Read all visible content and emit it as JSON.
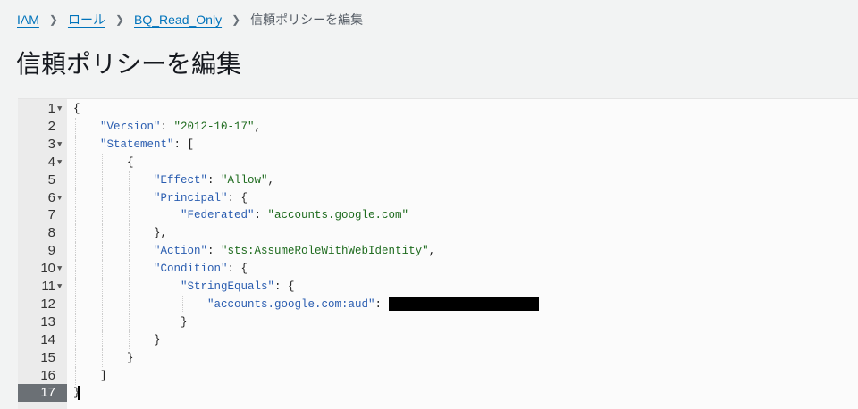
{
  "breadcrumb": [
    {
      "label": "IAM",
      "link": true
    },
    {
      "label": "ロール",
      "link": true
    },
    {
      "label": "BQ_Read_Only",
      "link": true
    },
    {
      "label": "信頼ポリシーを編集",
      "link": false
    }
  ],
  "page_title": "信頼ポリシーを編集",
  "editor": {
    "active_line": 17,
    "lines": [
      {
        "n": "1",
        "fold": true,
        "indent": 0,
        "tokens": [
          [
            "p",
            "{"
          ]
        ]
      },
      {
        "n": "2",
        "fold": false,
        "indent": 1,
        "tokens": [
          [
            "k",
            "\"Version\""
          ],
          [
            "p",
            ": "
          ],
          [
            "s",
            "\"2012-10-17\""
          ],
          [
            "p",
            ","
          ]
        ]
      },
      {
        "n": "3",
        "fold": true,
        "indent": 1,
        "tokens": [
          [
            "k",
            "\"Statement\""
          ],
          [
            "p",
            ": ["
          ]
        ]
      },
      {
        "n": "4",
        "fold": true,
        "indent": 2,
        "tokens": [
          [
            "p",
            "{"
          ]
        ]
      },
      {
        "n": "5",
        "fold": false,
        "indent": 3,
        "tokens": [
          [
            "k",
            "\"Effect\""
          ],
          [
            "p",
            ": "
          ],
          [
            "s",
            "\"Allow\""
          ],
          [
            "p",
            ","
          ]
        ]
      },
      {
        "n": "6",
        "fold": true,
        "indent": 3,
        "tokens": [
          [
            "k",
            "\"Principal\""
          ],
          [
            "p",
            ": {"
          ]
        ]
      },
      {
        "n": "7",
        "fold": false,
        "indent": 4,
        "tokens": [
          [
            "k",
            "\"Federated\""
          ],
          [
            "p",
            ": "
          ],
          [
            "s",
            "\"accounts.google.com\""
          ]
        ]
      },
      {
        "n": "8",
        "fold": false,
        "indent": 3,
        "tokens": [
          [
            "p",
            "},"
          ]
        ]
      },
      {
        "n": "9",
        "fold": false,
        "indent": 3,
        "tokens": [
          [
            "k",
            "\"Action\""
          ],
          [
            "p",
            ": "
          ],
          [
            "s",
            "\"sts:AssumeRoleWithWebIdentity\""
          ],
          [
            "p",
            ","
          ]
        ]
      },
      {
        "n": "10",
        "fold": true,
        "indent": 3,
        "tokens": [
          [
            "k",
            "\"Condition\""
          ],
          [
            "p",
            ": {"
          ]
        ]
      },
      {
        "n": "11",
        "fold": true,
        "indent": 4,
        "tokens": [
          [
            "k",
            "\"StringEquals\""
          ],
          [
            "p",
            ": {"
          ]
        ]
      },
      {
        "n": "12",
        "fold": false,
        "indent": 5,
        "tokens": [
          [
            "k",
            "\"accounts.google.com:aud\""
          ],
          [
            "p",
            ": "
          ],
          [
            "r",
            ""
          ]
        ]
      },
      {
        "n": "13",
        "fold": false,
        "indent": 4,
        "tokens": [
          [
            "p",
            "}"
          ]
        ]
      },
      {
        "n": "14",
        "fold": false,
        "indent": 3,
        "tokens": [
          [
            "p",
            "}"
          ]
        ]
      },
      {
        "n": "15",
        "fold": false,
        "indent": 2,
        "tokens": [
          [
            "p",
            "}"
          ]
        ]
      },
      {
        "n": "16",
        "fold": false,
        "indent": 1,
        "tokens": [
          [
            "p",
            "]"
          ]
        ]
      },
      {
        "n": "17",
        "fold": false,
        "indent": 0,
        "tokens": [
          [
            "p",
            "}"
          ]
        ]
      }
    ]
  }
}
